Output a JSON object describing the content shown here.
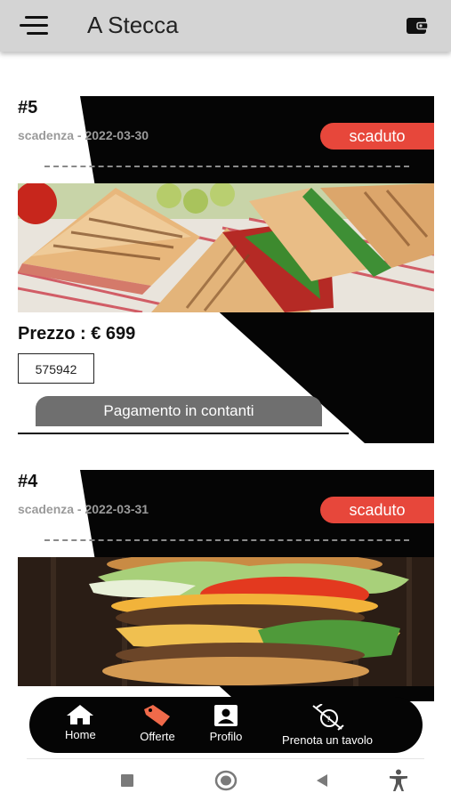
{
  "app": {
    "title": "A Stecca"
  },
  "cards": [
    {
      "number": "#5",
      "expiry": "scadenza - 2022-03-30",
      "status": "scaduto",
      "price": "Prezzo : € 699",
      "code": "575942",
      "payment_label": "Pagamento in contanti"
    },
    {
      "number": "#4",
      "expiry": "scadenza - 2022-03-31",
      "status": "scaduto"
    }
  ],
  "bottom_nav": {
    "items": [
      {
        "label": "Home",
        "icon": "home-icon"
      },
      {
        "label": "Offerte",
        "icon": "tag-icon"
      },
      {
        "label": "Profilo",
        "icon": "profile-icon"
      },
      {
        "label": "Prenota un tavolo",
        "icon": "reserve-table-icon"
      }
    ]
  },
  "colors": {
    "appbar": "#d4d4d4",
    "accent_badge": "#e7473b",
    "card_dark": "#050505",
    "button_gray": "#6f6f6f",
    "offerte_icon": "#f06a4a"
  }
}
